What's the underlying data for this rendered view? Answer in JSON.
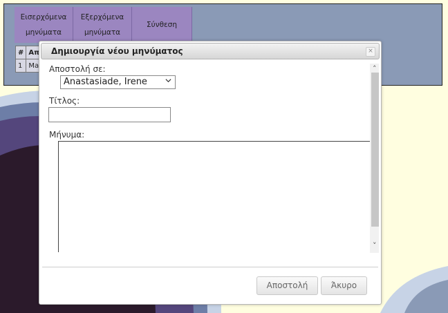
{
  "app": {
    "tabs": [
      {
        "line1": "Εισερχόμενα",
        "line2": "μηνύματα"
      },
      {
        "line1": "Εξερχόμενα",
        "line2": "μηνύματα"
      },
      {
        "label": "Σύνθεση"
      }
    ],
    "table": {
      "headers": [
        "#",
        "Απ"
      ],
      "rows": [
        [
          "1",
          "Ma"
        ]
      ]
    }
  },
  "dialog": {
    "title": "Δημιουργία νέου μηνύματος",
    "close_symbol": "×",
    "recipient_label": "Αποστολή σε:",
    "recipient_value": "Anastasiade, Irene",
    "subject_label": "Τίτλος:",
    "subject_value": "",
    "message_label": "Μήνυμα:",
    "message_value": "",
    "send_button": "Αποστολή",
    "cancel_button": "Άκυρο",
    "scroll_up": "˄",
    "scroll_down": "˅",
    "scroll_left": "<",
    "scroll_right": ">"
  },
  "colors": {
    "page_background": "#fffee0",
    "panel_background": "#8a9ab6",
    "tab_background": "#9b86c0",
    "dark_swirl": "#2b1a2b"
  }
}
